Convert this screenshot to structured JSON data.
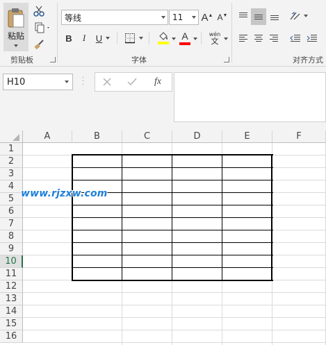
{
  "ribbon": {
    "clipboard": {
      "paste_label": "粘贴",
      "group_label": "剪贴板"
    },
    "font": {
      "font_name": "等线",
      "font_size": "11",
      "bold": "B",
      "italic": "I",
      "underline": "U",
      "font_color_glyph": "A",
      "highlight_color": "#ffff00",
      "font_color": "#ff0000",
      "phonetic_glyph": "文",
      "phonetic_top": "wén",
      "group_label": "字体"
    },
    "alignment": {
      "group_label": "对齐方式"
    }
  },
  "formula_bar": {
    "name_box": "H10",
    "fx_label": "fx",
    "value": ""
  },
  "grid": {
    "columns": [
      "A",
      "B",
      "C",
      "D",
      "E",
      "F"
    ],
    "rows": [
      "1",
      "2",
      "3",
      "4",
      "5",
      "6",
      "7",
      "8",
      "9",
      "10",
      "11",
      "12",
      "13",
      "14",
      "15",
      "16"
    ],
    "active_row": "10"
  },
  "watermark": "www.rjzxw.com"
}
